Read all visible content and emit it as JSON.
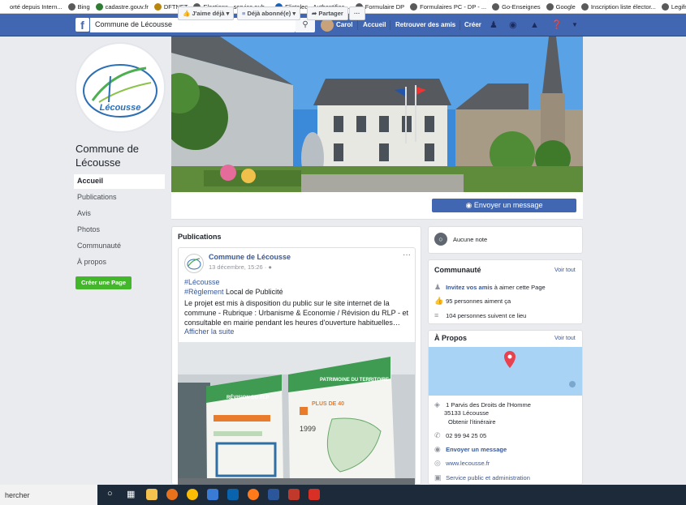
{
  "bookmarks": [
    {
      "label": "orté depuis Intern...",
      "color": "#ffffff"
    },
    {
      "label": "Bing",
      "color": "#5a5a5a"
    },
    {
      "label": "cadastre.gouv.fr",
      "color": "#2e7d32"
    },
    {
      "label": "DFTNET",
      "color": "#b8860b"
    },
    {
      "label": "Elections - service pub...",
      "color": "#5a5a5a"
    },
    {
      "label": "Elistelec - Authentifica...",
      "color": "#1565c0"
    },
    {
      "label": "Formulaire DP",
      "color": "#5a5a5a"
    },
    {
      "label": "Formulaires PC - DP - ...",
      "color": "#5a5a5a"
    },
    {
      "label": "Go-Enseignes",
      "color": "#5a5a5a"
    },
    {
      "label": "Google",
      "color": "#5a5a5a"
    },
    {
      "label": "Inscription liste élector...",
      "color": "#5a5a5a"
    },
    {
      "label": "Legifrance",
      "color": "#5a5a5a"
    }
  ],
  "topbar": {
    "logo": "f",
    "search_value": "Commune de Lécousse",
    "user_name": "Carol",
    "nav_home": "Accueil",
    "nav_friends": "Retrouver des amis",
    "nav_create": "Créer"
  },
  "page": {
    "logo_text": "Lécousse",
    "name": "Commune de Lécousse",
    "nav": [
      "Accueil",
      "Publications",
      "Avis",
      "Photos",
      "Communauté",
      "À propos"
    ],
    "create_page": "Créer une Page"
  },
  "actions": {
    "like": "J'aime déjà",
    "follow": "Déjà abonné(e)",
    "share": "Partager",
    "more": "···",
    "message": "Envoyer un message"
  },
  "publications": {
    "title": "Publications",
    "post_author": "Commune de Lécousse",
    "post_date": "13 décembre, 15:26 ·",
    "post_menu": "···",
    "hashtag1": "#Lécousse",
    "hashtag2": "#Règlement",
    "hashtag2_rest": " Local de Publicité",
    "body": "Le projet est mis à disposition du public sur le site internet de la commune - Rubrique : Urbanisme & Economie / Révision du RLP - et consultable en mairie pendant les heures d'ouverture habituelles…",
    "see_more": "Afficher la suite",
    "panel_left_title": "RÉVISION DU RLP",
    "panel_right_title": "PATRIMOINE DU TERRITOIRE",
    "panel_year": "1999",
    "panel_stat": "PLUS DE 40"
  },
  "sidebar": {
    "no_rating": "Aucune note",
    "community_title": "Communauté",
    "community_see_all": "Voir tout",
    "invite_link": "Invitez vos amis",
    "invite_rest": " à aimer cette Page",
    "likes": "95 personnes aiment ça",
    "followers": "104 personnes suivent ce lieu",
    "about_title": "À Propos",
    "about_see_all": "Voir tout",
    "address1": "1 Parvis des Droits de l'Homme",
    "address2": "35133 Lécousse",
    "directions": "Obtenir l'itinéraire",
    "phone": "02 99 94 25 05",
    "send_message": "Envoyer un message",
    "website": "www.lecousse.fr",
    "category": "Service public et administration"
  },
  "taskbar": {
    "search": "hercher"
  }
}
